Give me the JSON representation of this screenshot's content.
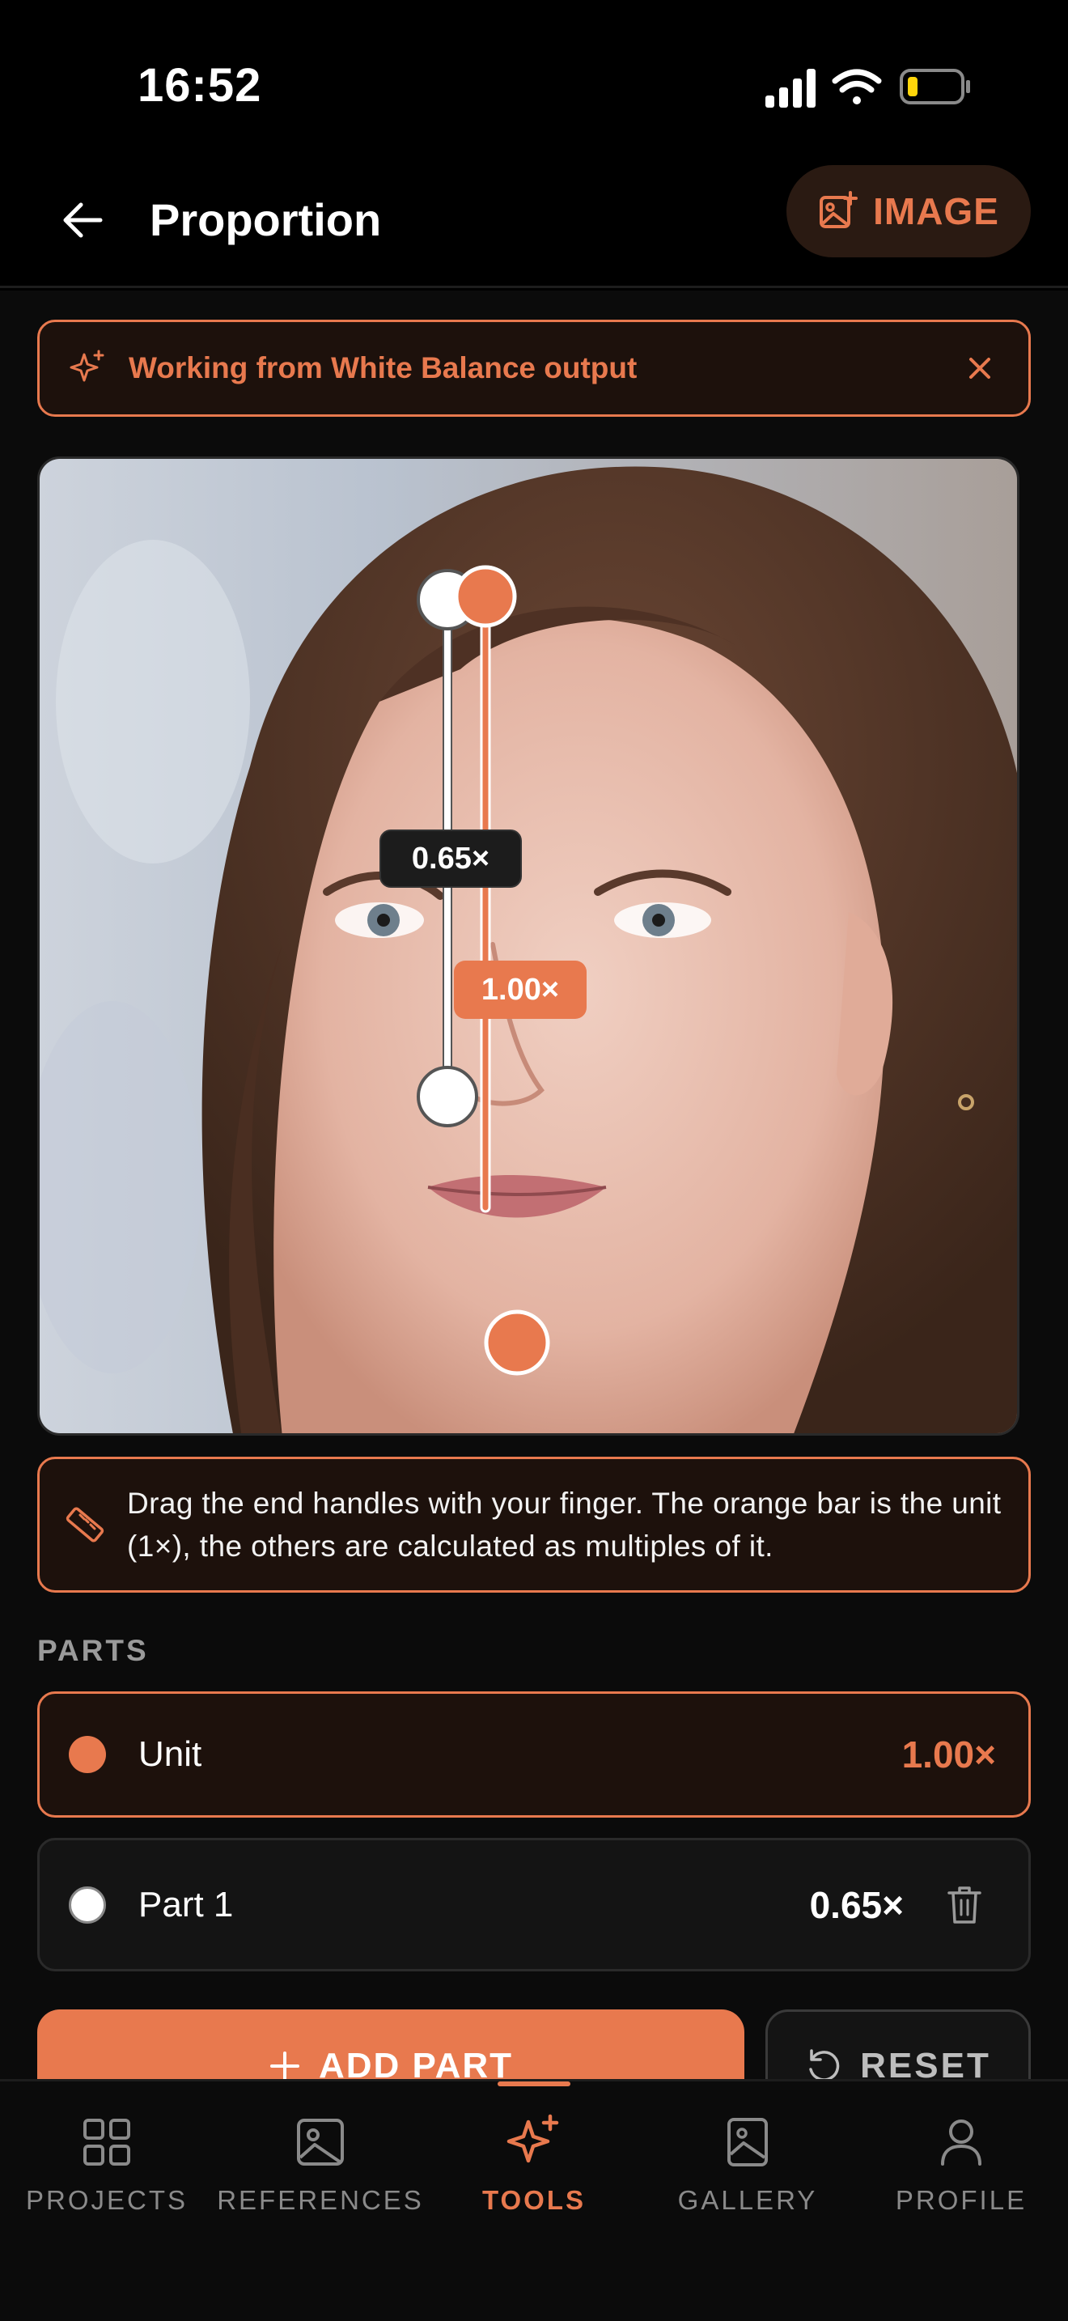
{
  "status_bar": {
    "time": "16:52",
    "battery_level": 0.2
  },
  "header": {
    "title": "Proportion",
    "image_button_label": "IMAGE"
  },
  "banner": {
    "text": "Working from White Balance output"
  },
  "canvas": {
    "ratio_part": "0.65×",
    "ratio_unit": "1.00×"
  },
  "hint": {
    "text": "Drag the end handles with your finger. The orange bar is the unit (1×), the others are calculated as multiples of it."
  },
  "parts_section": {
    "label": "PARTS",
    "items": [
      {
        "name": "Unit",
        "value": "1.00×",
        "color": "#e8794e"
      },
      {
        "name": "Part 1",
        "value": "0.65×",
        "color": "#ffffff"
      }
    ]
  },
  "actions": {
    "add_label": "ADD PART",
    "reset_label": "RESET"
  },
  "tabs": [
    {
      "label": "PROJECTS",
      "icon": "grid-icon"
    },
    {
      "label": "REFERENCES",
      "icon": "image-icon"
    },
    {
      "label": "TOOLS",
      "icon": "sparkle-icon",
      "active": true
    },
    {
      "label": "GALLERY",
      "icon": "gallery-icon"
    },
    {
      "label": "PROFILE",
      "icon": "person-icon"
    }
  ],
  "colors": {
    "accent": "#e8794e",
    "background": "#0b0b0b"
  }
}
